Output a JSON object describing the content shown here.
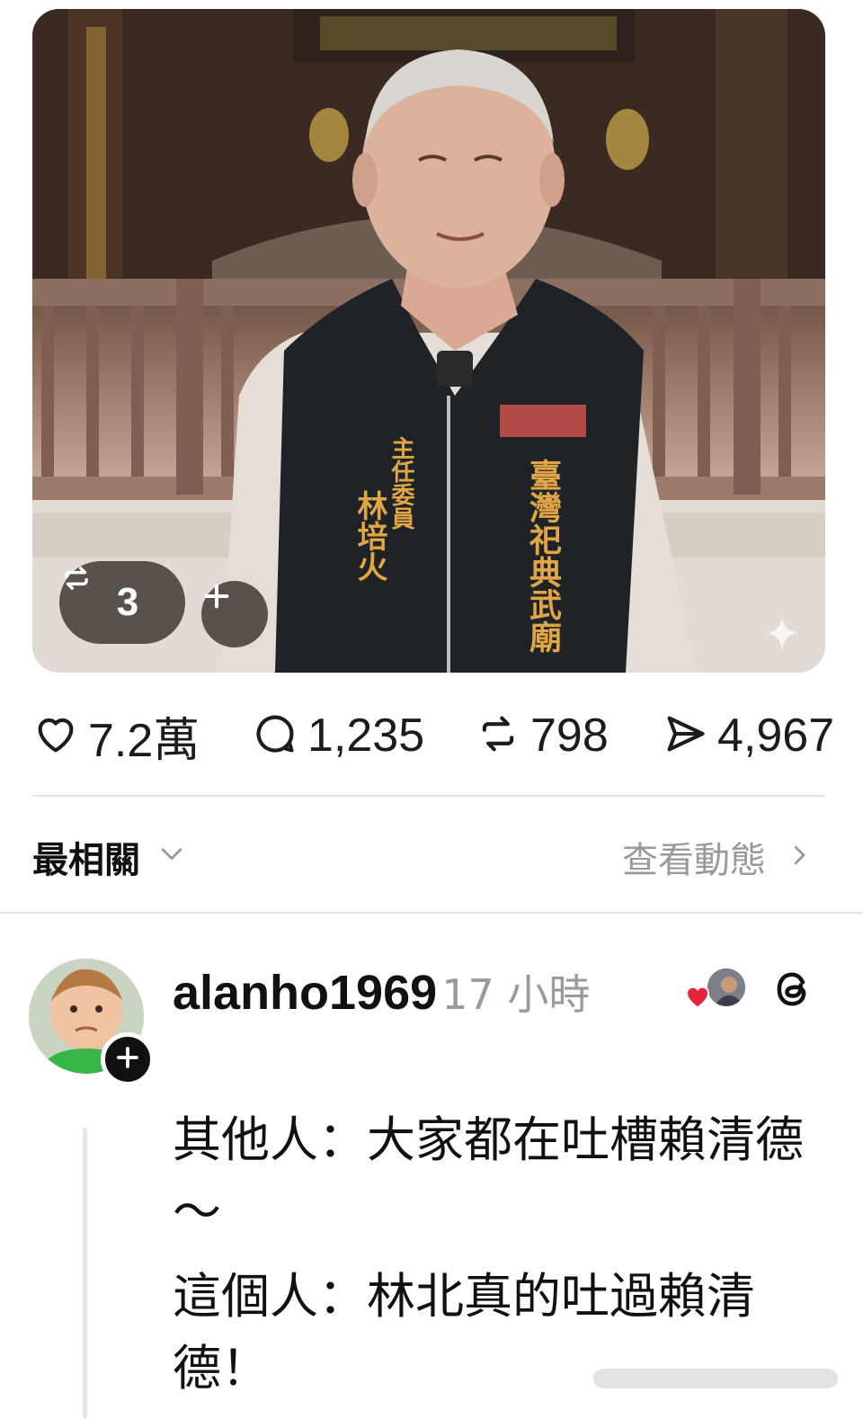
{
  "photo": {
    "vest_left_text": "主任委員 林培火",
    "vest_right_text": "臺灣祀典武廟",
    "repost_icon": "repost-icon",
    "repost_count": "3",
    "add_icon": "plus-icon",
    "sparkle_icon": "sparkle-icon"
  },
  "stats": {
    "likes": {
      "icon": "heart-icon",
      "value": "7.2萬"
    },
    "comments": {
      "icon": "comment-icon",
      "value": "1,235"
    },
    "reposts": {
      "icon": "repost-icon",
      "value": "798"
    },
    "shares": {
      "icon": "send-icon",
      "value": "4,967"
    }
  },
  "sortbar": {
    "sort_label": "最相關",
    "sort_icon": "chevron-down-icon",
    "view_activity": "查看動態",
    "view_icon": "chevron-right-icon"
  },
  "reply": {
    "username": "alanho1969",
    "time": "17 小時",
    "paragraphs": [
      "其他人：大家都在吐槽賴清德～",
      "這個人：林北真的吐過賴清德！"
    ]
  },
  "colors": {
    "vest": "#1f2226",
    "vest_text": "#e0a544",
    "pill": "#463e38",
    "heart": "#e8243c",
    "muted": "#9a9a9a"
  }
}
